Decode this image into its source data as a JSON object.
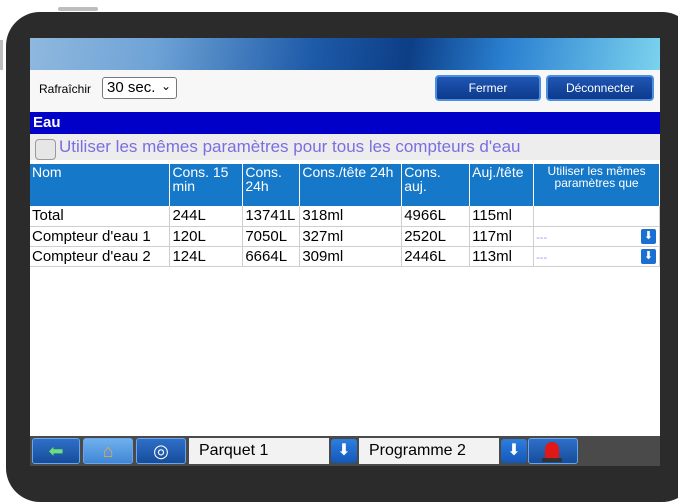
{
  "toolbar": {
    "refresh_label": "Rafraîchir",
    "refresh_value": "30 sec.",
    "close_label": "Fermer",
    "logout_label": "Déconnecter"
  },
  "section": {
    "title": "Eau",
    "same_params_label": "Utiliser les mêmes paramètres pour tous les compteurs d'eau",
    "same_params_checked": false
  },
  "table": {
    "headers": [
      "Nom",
      "Cons. 15 min",
      "Cons. 24h",
      "Cons./tête 24h",
      "Cons. auj.",
      "Auj./tête",
      "Utiliser les mêmes paramètres que"
    ],
    "rows": [
      {
        "name": "Total",
        "cons15": "244L",
        "cons24": "13741L",
        "head24": "318ml",
        "today": "4966L",
        "today_head": "115ml",
        "same": ""
      },
      {
        "name": "Compteur d'eau 1",
        "cons15": "120L",
        "cons24": "7050L",
        "head24": "327ml",
        "today": "2520L",
        "today_head": "117ml",
        "same": "---"
      },
      {
        "name": "Compteur d'eau 2",
        "cons15": "124L",
        "cons24": "6664L",
        "head24": "309ml",
        "today": "2446L",
        "today_head": "113ml",
        "same": "---"
      }
    ]
  },
  "bottom": {
    "house_select": "Parquet 1",
    "program_select": "Programme 2"
  },
  "icons": {
    "back": "back-arrow-icon",
    "home": "house-icon",
    "help": "lifebuoy-icon",
    "dropdown": "down-arrow-icon",
    "alarm": "alarm-light-icon"
  },
  "colors": {
    "section_title_bg": "#0000c8",
    "table_header_bg": "#1678c8",
    "link_text": "#7b6ee0",
    "button_bg": "#0d3a8c"
  }
}
